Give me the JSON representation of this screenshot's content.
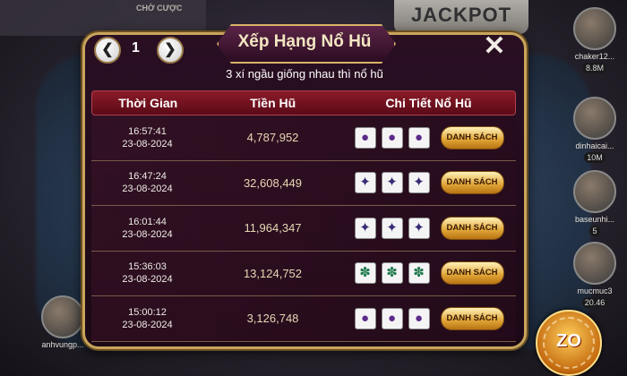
{
  "background": {
    "cho_cuoc": "CHỜ CƯỢC",
    "jackpot": "JACKPOT",
    "players": [
      {
        "name": "chaker12...",
        "money": "8.8M"
      },
      {
        "name": "dinhaicai...",
        "money": "10M"
      },
      {
        "name": "baseunhi...",
        "money": "5"
      },
      {
        "name": "mucmuc3",
        "money": "20.46"
      },
      {
        "name": "anhvungp...",
        "money": ""
      }
    ],
    "logo": "ZO"
  },
  "dialog": {
    "title": "Xếp Hạng Nổ Hũ",
    "page": "1",
    "prev_icon": "chevron-left-icon",
    "next_icon": "chevron-right-icon",
    "close_icon": "close-icon",
    "subtitle": "3 xí ngầu giống nhau thì nổ hũ",
    "headers": {
      "time": "Thời Gian",
      "amount": "Tiền Hũ",
      "detail": "Chi Tiết Nổ Hũ"
    },
    "list_button_label": "DANH SÁCH",
    "rows": [
      {
        "time": "16:57:41",
        "date": "23-08-2024",
        "amount": "4,787,952",
        "dice": "gourd"
      },
      {
        "time": "16:47:24",
        "date": "23-08-2024",
        "amount": "32,608,449",
        "dice": "deer"
      },
      {
        "time": "16:01:44",
        "date": "23-08-2024",
        "amount": "11,964,347",
        "dice": "deer"
      },
      {
        "time": "15:36:03",
        "date": "23-08-2024",
        "amount": "13,124,752",
        "dice": "crab"
      },
      {
        "time": "15:00:12",
        "date": "23-08-2024",
        "amount": "3,126,748",
        "dice": "gourd"
      }
    ]
  },
  "colors": {
    "header_red": "#8b1a28",
    "gold_border": "#c9a55c",
    "button_gold": "#e0a435"
  }
}
